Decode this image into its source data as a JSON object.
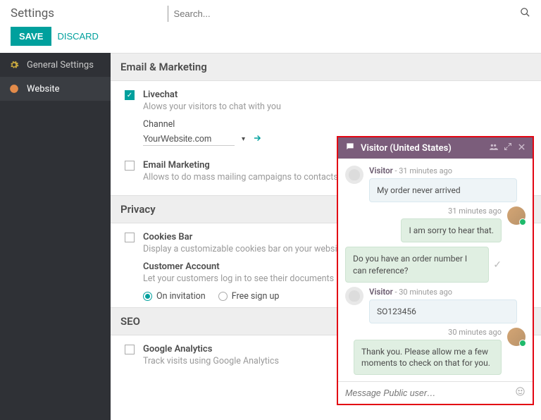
{
  "title": "Settings",
  "search_placeholder": "Search...",
  "buttons": {
    "save": "SAVE",
    "discard": "DISCARD"
  },
  "sidebar": {
    "items": [
      {
        "label": "General Settings",
        "icon": "gear"
      },
      {
        "label": "Website",
        "icon": "globe"
      }
    ]
  },
  "sections": {
    "email": {
      "title": "Email & Marketing",
      "livechat": {
        "title": "Livechat",
        "desc": "Alows your visitors to chat with you",
        "channel_label": "Channel",
        "channel_value": "YourWebsite.com"
      },
      "email_marketing": {
        "title": "Email Marketing",
        "desc": "Allows to do mass mailing campaigns to contacts"
      }
    },
    "privacy": {
      "title": "Privacy",
      "cookies": {
        "title": "Cookies Bar",
        "desc": "Display a customizable cookies bar on your website"
      },
      "account": {
        "title": "Customer Account",
        "desc": "Let your customers log in to see their documents",
        "opt1": "On invitation",
        "opt2": "Free sign up"
      }
    },
    "seo": {
      "title": "SEO",
      "ga": {
        "title": "Google Analytics",
        "desc": "Track visits using Google Analytics"
      }
    }
  },
  "chat": {
    "title": "Visitor (United States)",
    "input_placeholder": "Message Public user…",
    "messages": [
      {
        "from": "visitor",
        "name": "Visitor",
        "time": "- 31 minutes ago",
        "text": "My order never arrived"
      },
      {
        "from": "agent",
        "time": "31 minutes ago",
        "text": "I am sorry to hear that."
      },
      {
        "from": "agent",
        "text": "Do you have an order number I can reference?"
      },
      {
        "from": "visitor",
        "name": "Visitor",
        "time": "- 30 minutes ago",
        "text": "SO123456"
      },
      {
        "from": "agent",
        "time": "30 minutes ago",
        "text": "Thank you. Please allow me a few moments to check on that for you."
      }
    ]
  }
}
